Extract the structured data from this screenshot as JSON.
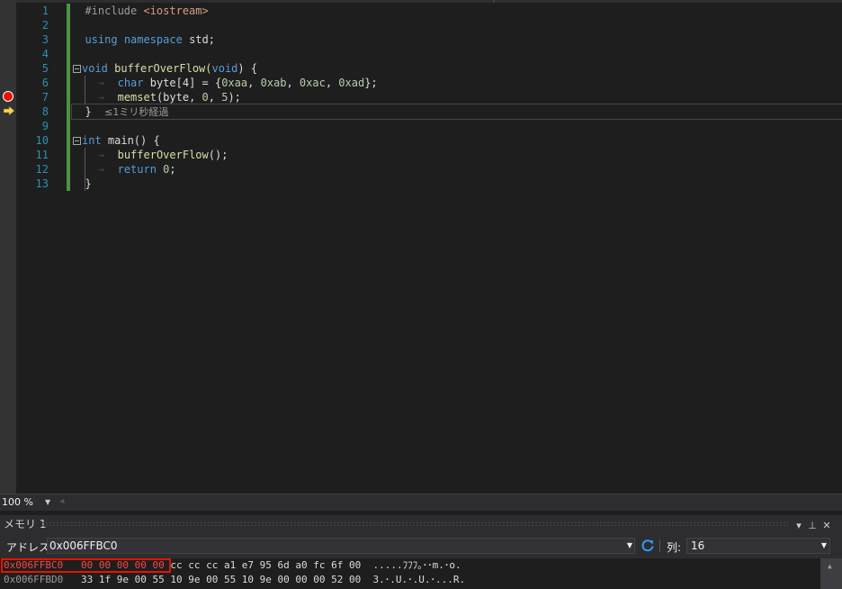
{
  "editor": {
    "line_numbers": [
      "1",
      "2",
      "3",
      "4",
      "5",
      "6",
      "7",
      "8",
      "9",
      "10",
      "11",
      "12",
      "13"
    ],
    "lines": {
      "l1": {
        "pp": "#include ",
        "str": "<iostream>"
      },
      "l3": {
        "kw1": "using",
        "kw2": "namespace",
        "rest": " std;"
      },
      "l5": {
        "kw": "void",
        "fn": " bufferOverFlow(",
        "kw2": "void",
        "rest": ") {"
      },
      "l6": {
        "kw": "char",
        "rest": " byte[4] = {",
        "n1": "0xaa",
        "c1": ", ",
        "n2": "0xab",
        "c2": ", ",
        "n3": "0xac",
        "c3": ", ",
        "n4": "0xad",
        "end": "};"
      },
      "l7": {
        "fn": "memset",
        "rest": "(byte, ",
        "n1": "0",
        "c1": ", ",
        "n2": "5",
        "end": ");"
      },
      "l8": {
        "brace": "}",
        "perf": "≤1ミリ秒経過"
      },
      "l10": {
        "kw": "int",
        "rest": " main() {"
      },
      "l11": {
        "fn": "bufferOverFlow",
        "rest": "();"
      },
      "l12": {
        "kw": "return",
        "n": " 0",
        "end": ";"
      },
      "l13": {
        "brace": "}"
      }
    },
    "zoom": "100 %"
  },
  "memory_panel": {
    "title": "メモリ 1",
    "address_label": "アドレス:",
    "address_value": "0x006FFBC0",
    "column_label": "列:",
    "column_value": "16",
    "rows": [
      {
        "address": "0x006FFBC0",
        "changed": "00 00 00 00 00",
        "bytes": " cc cc cc a1 e7 95 6d a0 fc 6f 00",
        "ascii": ".....ﾌﾌﾌ｡･･m.･o."
      },
      {
        "address": "0x006FFBD0",
        "changed": "",
        "bytes": "33 1f 9e 00 55 10 9e 00 55 10 9e 00 00 00 52 00",
        "ascii": "3.･.U.･.U.･...R."
      }
    ]
  },
  "colors": {
    "background": "#1e1e1e",
    "keyword": "#569cd6",
    "string": "#d69d85",
    "line_number": "#2b91af",
    "breakpoint": "#e51400",
    "changed_bytes": "#f44747"
  }
}
